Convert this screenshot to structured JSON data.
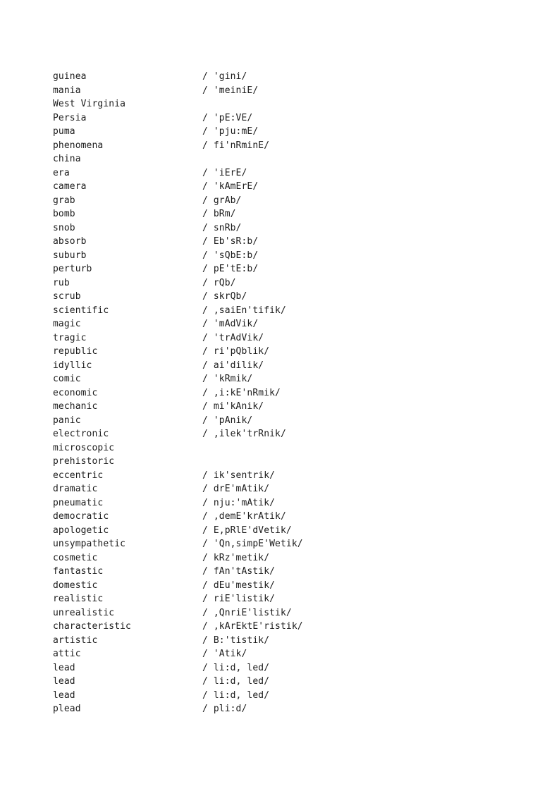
{
  "document": {
    "type": "word-list-with-phonetic-transcriptions",
    "background_color": "#ffffff",
    "text_color": "#1c1c1c",
    "column_headers_visible": false,
    "entries": [
      {
        "word": "guinea",
        "phonetic": "/ 'gini/"
      },
      {
        "word": "mania",
        "phonetic": "/ 'meiniE/"
      },
      {
        "word": "West Virginia",
        "phonetic": ""
      },
      {
        "word": "Persia",
        "phonetic": "/ 'pE:VE/"
      },
      {
        "word": "puma",
        "phonetic": "/ 'pju:mE/"
      },
      {
        "word": "phenomena",
        "phonetic": "/ fi'nRminE/"
      },
      {
        "word": "china",
        "phonetic": ""
      },
      {
        "word": "era",
        "phonetic": "/ 'iErE/"
      },
      {
        "word": "camera",
        "phonetic": "/ 'kAmErE/"
      },
      {
        "word": "grab",
        "phonetic": "/ grAb/"
      },
      {
        "word": "bomb",
        "phonetic": "/ bRm/"
      },
      {
        "word": "snob",
        "phonetic": "/ snRb/"
      },
      {
        "word": "absorb",
        "phonetic": "/ Eb'sR:b/"
      },
      {
        "word": "suburb",
        "phonetic": "/ 'sQbE:b/"
      },
      {
        "word": "perturb",
        "phonetic": "/ pE'tE:b/"
      },
      {
        "word": "rub",
        "phonetic": "/ rQb/"
      },
      {
        "word": "scrub",
        "phonetic": "/ skrQb/"
      },
      {
        "word": "scientific",
        "phonetic": "/ ,saiEn'tifik/"
      },
      {
        "word": "magic",
        "phonetic": "/ 'mAdVik/"
      },
      {
        "word": "tragic",
        "phonetic": "/ 'trAdVik/"
      },
      {
        "word": "republic",
        "phonetic": "/ ri'pQblik/"
      },
      {
        "word": "idyllic",
        "phonetic": "/ ai'dilik/"
      },
      {
        "word": "comic",
        "phonetic": "/ 'kRmik/"
      },
      {
        "word": "economic",
        "phonetic": "/ ,i:kE'nRmik/"
      },
      {
        "word": "mechanic",
        "phonetic": "/ mi'kAnik/"
      },
      {
        "word": "panic",
        "phonetic": "/ 'pAnik/"
      },
      {
        "word": "electronic",
        "phonetic": "/ ,ilek'trRnik/"
      },
      {
        "word": "microscopic",
        "phonetic": ""
      },
      {
        "word": "prehistoric",
        "phonetic": ""
      },
      {
        "word": "eccentric",
        "phonetic": "/ ik'sentrik/"
      },
      {
        "word": "dramatic",
        "phonetic": "/ drE'mAtik/"
      },
      {
        "word": "pneumatic",
        "phonetic": "/ nju:'mAtik/"
      },
      {
        "word": "democratic",
        "phonetic": "/ ,demE'krAtik/"
      },
      {
        "word": "apologetic",
        "phonetic": "/ E,pRlE'dVetik/"
      },
      {
        "word": "unsympathetic",
        "phonetic": "/ 'Qn,simpE'Wetik/"
      },
      {
        "word": "cosmetic",
        "phonetic": "/ kRz'metik/"
      },
      {
        "word": "fantastic",
        "phonetic": "/ fAn'tAstik/"
      },
      {
        "word": "domestic",
        "phonetic": "/ dEu'mestik/"
      },
      {
        "word": "realistic",
        "phonetic": "/ riE'listik/"
      },
      {
        "word": "unrealistic",
        "phonetic": "/ ,QnriE'listik/"
      },
      {
        "word": "characteristic",
        "phonetic": "/ ,kArEktE'ristik/"
      },
      {
        "word": "artistic",
        "phonetic": "/ B:'tistik/"
      },
      {
        "word": "attic",
        "phonetic": "/ 'Atik/"
      },
      {
        "word": "lead",
        "phonetic": "/ li:d, led/"
      },
      {
        "word": "lead",
        "phonetic": "/ li:d, led/"
      },
      {
        "word": "lead",
        "phonetic": "/ li:d, led/"
      },
      {
        "word": "plead",
        "phonetic": "/ pli:d/"
      }
    ]
  }
}
